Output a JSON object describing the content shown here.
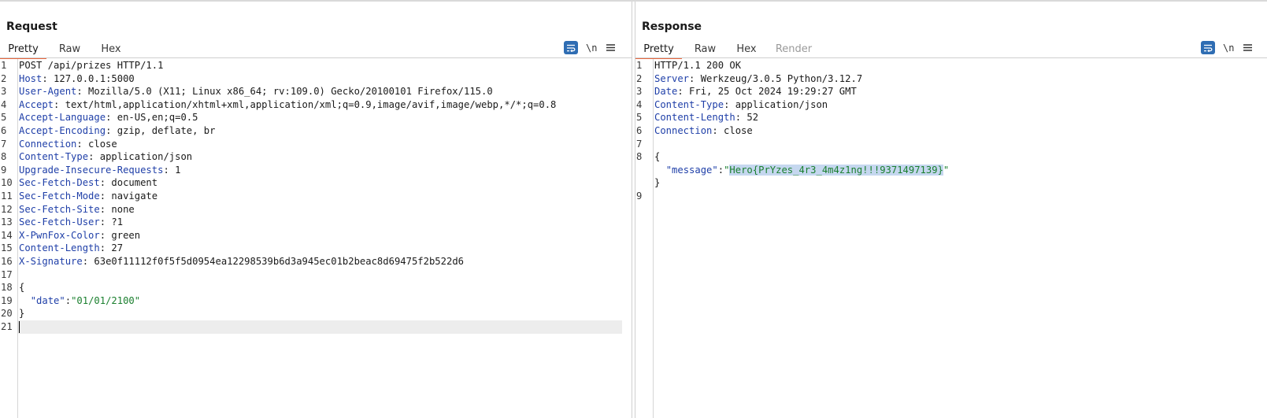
{
  "request": {
    "title": "Request",
    "tabs": [
      "Pretty",
      "Raw",
      "Hex"
    ],
    "active_tab": "Pretty",
    "wrap_icon": "wrap-lines-icon",
    "newline_label": "\\n",
    "menu_icon": "hamburger-icon",
    "lines": [
      {
        "n": "1",
        "segs": [
          {
            "t": "v",
            "s": "POST /api/prizes HTTP/1.1"
          }
        ]
      },
      {
        "n": "2",
        "segs": [
          {
            "t": "k",
            "s": "Host"
          },
          {
            "t": "v",
            "s": ": 127.0.0.1:5000"
          }
        ]
      },
      {
        "n": "3",
        "segs": [
          {
            "t": "k",
            "s": "User-Agent"
          },
          {
            "t": "v",
            "s": ": Mozilla/5.0 (X11; Linux x86_64; rv:109.0) Gecko/20100101 Firefox/115.0"
          }
        ]
      },
      {
        "n": "4",
        "segs": [
          {
            "t": "k",
            "s": "Accept"
          },
          {
            "t": "v",
            "s": ": text/html,application/xhtml+xml,application/xml;q=0.9,image/avif,image/webp,*/*;q=0.8"
          }
        ]
      },
      {
        "n": "5",
        "segs": [
          {
            "t": "k",
            "s": "Accept-Language"
          },
          {
            "t": "v",
            "s": ": en-US,en;q=0.5"
          }
        ]
      },
      {
        "n": "6",
        "segs": [
          {
            "t": "k",
            "s": "Accept-Encoding"
          },
          {
            "t": "v",
            "s": ": gzip, deflate, br"
          }
        ]
      },
      {
        "n": "7",
        "segs": [
          {
            "t": "k",
            "s": "Connection"
          },
          {
            "t": "v",
            "s": ": close"
          }
        ]
      },
      {
        "n": "8",
        "segs": [
          {
            "t": "k",
            "s": "Content-Type"
          },
          {
            "t": "v",
            "s": ": application/json"
          }
        ]
      },
      {
        "n": "9",
        "segs": [
          {
            "t": "k",
            "s": "Upgrade-Insecure-Requests"
          },
          {
            "t": "v",
            "s": ": 1"
          }
        ]
      },
      {
        "n": "10",
        "segs": [
          {
            "t": "k",
            "s": "Sec-Fetch-Dest"
          },
          {
            "t": "v",
            "s": ": document"
          }
        ]
      },
      {
        "n": "11",
        "segs": [
          {
            "t": "k",
            "s": "Sec-Fetch-Mode"
          },
          {
            "t": "v",
            "s": ": navigate"
          }
        ]
      },
      {
        "n": "12",
        "segs": [
          {
            "t": "k",
            "s": "Sec-Fetch-Site"
          },
          {
            "t": "v",
            "s": ": none"
          }
        ]
      },
      {
        "n": "13",
        "segs": [
          {
            "t": "k",
            "s": "Sec-Fetch-User"
          },
          {
            "t": "v",
            "s": ": ?1"
          }
        ]
      },
      {
        "n": "14",
        "segs": [
          {
            "t": "k",
            "s": "X-PwnFox-Color"
          },
          {
            "t": "v",
            "s": ": green"
          }
        ]
      },
      {
        "n": "15",
        "segs": [
          {
            "t": "k",
            "s": "Content-Length"
          },
          {
            "t": "v",
            "s": ": 27"
          }
        ]
      },
      {
        "n": "16",
        "segs": [
          {
            "t": "k",
            "s": "X-Signature"
          },
          {
            "t": "v",
            "s": ": 63e0f11112f0f5f5d0954ea12298539b6d3a945ec01b2beac8d69475f2b522d6"
          }
        ]
      },
      {
        "n": "17",
        "segs": []
      },
      {
        "n": "18",
        "segs": [
          {
            "t": "v",
            "s": "{"
          }
        ]
      },
      {
        "n": "19",
        "segs": [
          {
            "t": "v",
            "s": "  "
          },
          {
            "t": "jk",
            "s": "\"date\""
          },
          {
            "t": "v",
            "s": ":"
          },
          {
            "t": "str",
            "s": "\"01/01/2100\""
          }
        ]
      },
      {
        "n": "20",
        "segs": [
          {
            "t": "v",
            "s": "}"
          }
        ]
      },
      {
        "n": "21",
        "segs": []
      }
    ],
    "current_line": "21"
  },
  "response": {
    "title": "Response",
    "tabs": [
      "Pretty",
      "Raw",
      "Hex",
      "Render"
    ],
    "active_tab": "Pretty",
    "wrap_icon": "wrap-lines-icon",
    "newline_label": "\\n",
    "menu_icon": "hamburger-icon",
    "lines": [
      {
        "n": "1",
        "segs": [
          {
            "t": "v",
            "s": "HTTP/1.1 200 OK"
          }
        ]
      },
      {
        "n": "2",
        "segs": [
          {
            "t": "k",
            "s": "Server"
          },
          {
            "t": "v",
            "s": ": Werkzeug/3.0.5 Python/3.12.7"
          }
        ]
      },
      {
        "n": "3",
        "segs": [
          {
            "t": "k",
            "s": "Date"
          },
          {
            "t": "v",
            "s": ": Fri, 25 Oct 2024 19:29:27 GMT"
          }
        ]
      },
      {
        "n": "4",
        "segs": [
          {
            "t": "k",
            "s": "Content-Type"
          },
          {
            "t": "v",
            "s": ": application/json"
          }
        ]
      },
      {
        "n": "5",
        "segs": [
          {
            "t": "k",
            "s": "Content-Length"
          },
          {
            "t": "v",
            "s": ": 52"
          }
        ]
      },
      {
        "n": "6",
        "segs": [
          {
            "t": "k",
            "s": "Connection"
          },
          {
            "t": "v",
            "s": ": close"
          }
        ]
      },
      {
        "n": "7",
        "segs": []
      },
      {
        "n": "8",
        "segs": [
          {
            "t": "v",
            "s": "{"
          }
        ]
      },
      {
        "n": "",
        "segs": [
          {
            "t": "v",
            "s": "  "
          },
          {
            "t": "jk",
            "s": "\"message\""
          },
          {
            "t": "v",
            "s": ":"
          },
          {
            "t": "str",
            "s": "\""
          },
          {
            "t": "str hl",
            "s": "Hero{PrYzes_4r3_4m4z1ng!!!9371497139}"
          },
          {
            "t": "str",
            "s": "\""
          }
        ]
      },
      {
        "n": "",
        "segs": [
          {
            "t": "v",
            "s": "}"
          }
        ]
      },
      {
        "n": "9",
        "segs": []
      }
    ]
  },
  "layout_toggle": {
    "icons": [
      "side-by-side-layout-icon",
      "stacked-layout-icon",
      "tabbed-layout-icon"
    ],
    "active": "side-by-side-layout-icon"
  },
  "colors": {
    "accent_tab": "#e8663d",
    "header_key": "#1f3fa8",
    "json_string": "#1a7f2e",
    "button_blue": "#2f6db3",
    "selection": "#c5d7ef"
  }
}
